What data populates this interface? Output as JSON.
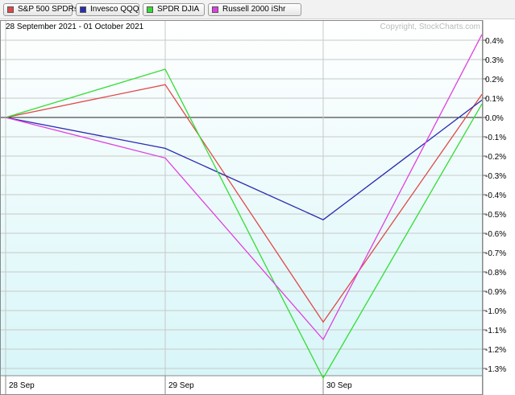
{
  "legend": [
    {
      "label": "S&P 500 SPDRs",
      "color": "#e04848"
    },
    {
      "label": "Invesco QQQ",
      "color": "#2b2bb0"
    },
    {
      "label": "SPDR DJIA",
      "color": "#33dd33"
    },
    {
      "label": "Russell 2000 iShr",
      "color": "#e040e0"
    }
  ],
  "date_range": "28 September 2021 - 01 October 2021",
  "copyright": "Copyright, StockCharts.com",
  "chart_data": {
    "type": "line",
    "categories": [
      "28  Sep",
      "29  Sep",
      "30  Sep",
      "01 Oct"
    ],
    "series": [
      {
        "name": "S&P 500 SPDRs",
        "color": "#e04848",
        "values": [
          0.0,
          0.17,
          -1.06,
          0.12
        ]
      },
      {
        "name": "Invesco QQQ",
        "color": "#2b2bb0",
        "values": [
          0.0,
          -0.16,
          -0.53,
          0.09
        ]
      },
      {
        "name": "SPDR DJIA",
        "color": "#33dd33",
        "values": [
          0.0,
          0.25,
          -1.35,
          0.07
        ]
      },
      {
        "name": "Russell 2000 iShr",
        "color": "#e040e0",
        "values": [
          0.0,
          -0.21,
          -1.15,
          0.43
        ]
      }
    ],
    "x_tick_labels": [
      "28  Sep",
      "29  Sep",
      "30  Sep"
    ],
    "y_tick_labels": [
      "0.4%",
      "0.3%",
      "0.2%",
      "0.1%",
      "0.0%",
      "-0.1%",
      "-0.2%",
      "-0.3%",
      "-0.4%",
      "-0.5%",
      "-0.6%",
      "-0.7%",
      "-0.8%",
      "-0.9%",
      "-1.0%",
      "-1.1%",
      "-1.2%",
      "-1.3%"
    ],
    "y_ticks": [
      0.4,
      0.3,
      0.2,
      0.1,
      0.0,
      -0.1,
      -0.2,
      -0.3,
      -0.4,
      -0.5,
      -0.6,
      -0.7,
      -0.8,
      -0.9,
      -1.0,
      -1.1,
      -1.2,
      -1.3
    ],
    "ylim": [
      -1.38,
      0.47
    ],
    "grid": true,
    "zero_line": true,
    "legend_position": "top"
  }
}
